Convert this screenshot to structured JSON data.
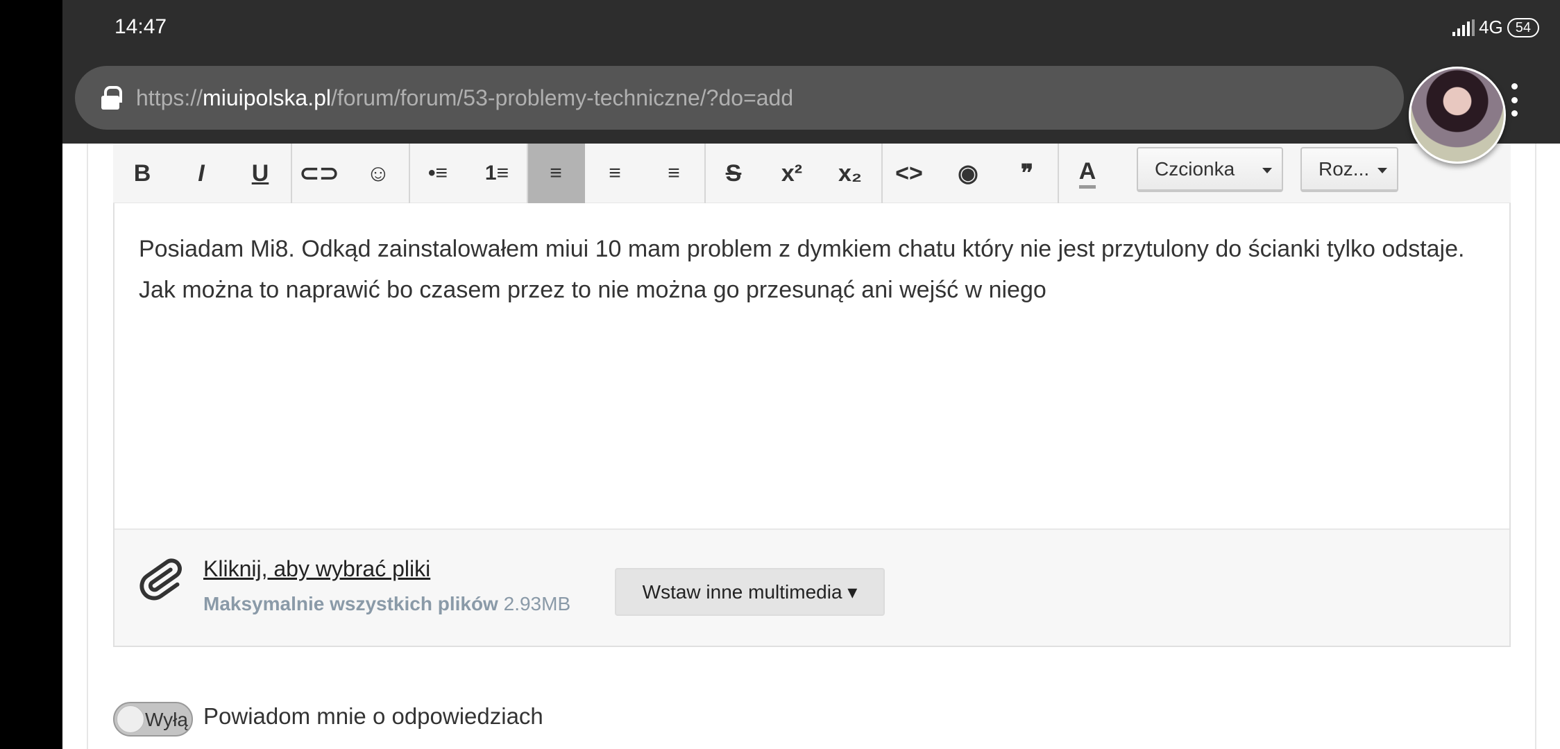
{
  "status_bar": {
    "time": "14:47",
    "network": "4G",
    "battery": "54"
  },
  "browser": {
    "url_scheme": "https://",
    "url_host": "miuipolska.pl",
    "url_path": "/forum/forum/53-problemy-techniczne/?do=add"
  },
  "toolbar": {
    "buttons": [
      {
        "label": "B",
        "name": "bold"
      },
      {
        "label": "I",
        "name": "italic"
      },
      {
        "label": "U",
        "name": "underline"
      },
      {
        "label": "⊂⊃",
        "name": "link"
      },
      {
        "label": "☺",
        "name": "emoji"
      },
      {
        "label": "•≡",
        "name": "bullet-list"
      },
      {
        "label": "1≡",
        "name": "numbered-list"
      },
      {
        "label": "≡",
        "name": "align-left"
      },
      {
        "label": "≡",
        "name": "align-center"
      },
      {
        "label": "≡",
        "name": "align-right"
      },
      {
        "label": "S",
        "name": "strikethrough"
      },
      {
        "label": "x²",
        "name": "superscript"
      },
      {
        "label": "x₂",
        "name": "subscript"
      },
      {
        "label": "<>",
        "name": "code"
      },
      {
        "label": "◉",
        "name": "preview"
      },
      {
        "label": "❞",
        "name": "quote"
      },
      {
        "label": "A",
        "name": "text-color"
      }
    ],
    "font_dropdown": "Czcionka",
    "size_dropdown": "Roz..."
  },
  "editor": {
    "content": "Posiadam Mi8. Odkąd zainstalowałem miui 10 mam problem z dymkiem chatu który nie jest przytulony do ścianki tylko odstaje. Jak można to naprawić bo czasem przez to nie można go przesunąć ani wejść w niego"
  },
  "attachments": {
    "pick_label": "Kliknij, aby wybrać pliki",
    "max_label": "Maksymalnie wszystkich plików",
    "max_value": "2.93MB",
    "insert_media": "Wstaw inne multimedia ▾"
  },
  "notify": {
    "toggle_text": "Wyłą",
    "label": "Powiadom mnie o odpowiedziach"
  }
}
